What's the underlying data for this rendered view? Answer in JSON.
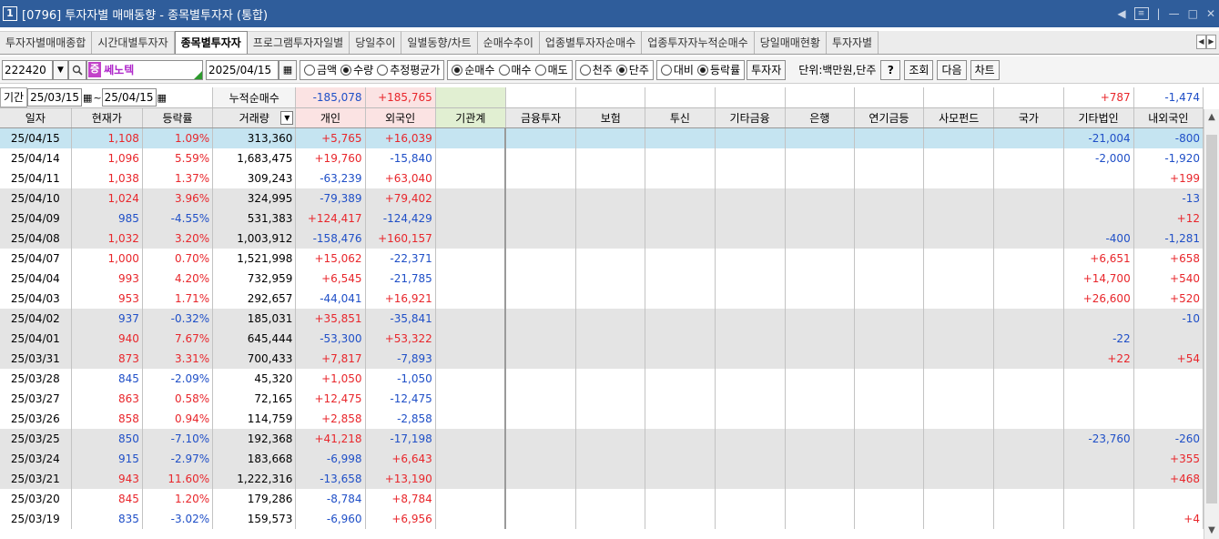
{
  "window": {
    "number": "1",
    "title": "[0796] 투자자별 매매동향 - 종목별투자자 (통합)"
  },
  "tabs": [
    {
      "label": "투자자별매매종합"
    },
    {
      "label": "시간대별투자자"
    },
    {
      "label": "종목별투자자",
      "active": true
    },
    {
      "label": "프로그램투자자일별"
    },
    {
      "label": "당일추이"
    },
    {
      "label": "일별동향/차트"
    },
    {
      "label": "순매수추이"
    },
    {
      "label": "업종별투자자순매수"
    },
    {
      "label": "업종투자자누적순매수"
    },
    {
      "label": "당일매매현황"
    },
    {
      "label": "투자자별"
    }
  ],
  "toolbar": {
    "code": "222420",
    "badge": "증",
    "name": "쎄노텍",
    "date": "2025/04/15",
    "amount_group": [
      "금액",
      "수량",
      "추정평균가"
    ],
    "amount_selected": 1,
    "trade_group": [
      "순매수",
      "매수",
      "매도"
    ],
    "trade_selected": 0,
    "unit_group": [
      "천주",
      "단주"
    ],
    "unit_selected": 1,
    "rate_group": [
      "대비",
      "등락률"
    ],
    "rate_selected": 1,
    "investor_btn": "투자자",
    "unit_label": "단위:백만원,단주",
    "help_btn": "?",
    "query_btn": "조회",
    "next_btn": "다음",
    "chart_btn": "차트"
  },
  "period": {
    "label": "기간",
    "from": "25/03/15",
    "to": "25/04/15",
    "cum_label": "누적순매수"
  },
  "summary": {
    "indiv": "-185,078",
    "foreign": "+185,765",
    "etc_corp": "+787",
    "domestic_foreign": "-1,474"
  },
  "columns": [
    "일자",
    "현재가",
    "등락률",
    "거래량",
    "개인",
    "외국인",
    "기관계",
    "금융투자",
    "보험",
    "투신",
    "기타금융",
    "은행",
    "연기금등",
    "사모펀드",
    "국가",
    "기타법인",
    "내외국인"
  ],
  "rows": [
    {
      "date": "25/04/15",
      "price": "1,108",
      "rate": "1.09%",
      "vol": "313,360",
      "indiv": "+5,765",
      "foreign": "+16,039",
      "etc_corp": "-21,004",
      "dom": "-800",
      "dir": "up",
      "style": "sel"
    },
    {
      "date": "25/04/14",
      "price": "1,096",
      "rate": "5.59%",
      "vol": "1,683,475",
      "indiv": "+19,760",
      "foreign": "-15,840",
      "etc_corp": "-2,000",
      "dom": "-1,920",
      "dir": "up",
      "style": ""
    },
    {
      "date": "25/04/11",
      "price": "1,038",
      "rate": "1.37%",
      "vol": "309,243",
      "indiv": "-63,239",
      "foreign": "+63,040",
      "etc_corp": "",
      "dom": "+199",
      "dir": "up",
      "style": ""
    },
    {
      "date": "25/04/10",
      "price": "1,024",
      "rate": "3.96%",
      "vol": "324,995",
      "indiv": "-79,389",
      "foreign": "+79,402",
      "etc_corp": "",
      "dom": "-13",
      "dir": "up",
      "style": "gray"
    },
    {
      "date": "25/04/09",
      "price": "985",
      "rate": "-4.55%",
      "vol": "531,383",
      "indiv": "+124,417",
      "foreign": "-124,429",
      "etc_corp": "",
      "dom": "+12",
      "dir": "dn",
      "style": "gray"
    },
    {
      "date": "25/04/08",
      "price": "1,032",
      "rate": "3.20%",
      "vol": "1,003,912",
      "indiv": "-158,476",
      "foreign": "+160,157",
      "etc_corp": "-400",
      "dom": "-1,281",
      "dir": "up",
      "style": "gray"
    },
    {
      "date": "25/04/07",
      "price": "1,000",
      "rate": "0.70%",
      "vol": "1,521,998",
      "indiv": "+15,062",
      "foreign": "-22,371",
      "etc_corp": "+6,651",
      "dom": "+658",
      "dir": "up",
      "style": ""
    },
    {
      "date": "25/04/04",
      "price": "993",
      "rate": "4.20%",
      "vol": "732,959",
      "indiv": "+6,545",
      "foreign": "-21,785",
      "etc_corp": "+14,700",
      "dom": "+540",
      "dir": "up",
      "style": ""
    },
    {
      "date": "25/04/03",
      "price": "953",
      "rate": "1.71%",
      "vol": "292,657",
      "indiv": "-44,041",
      "foreign": "+16,921",
      "etc_corp": "+26,600",
      "dom": "+520",
      "dir": "up",
      "style": ""
    },
    {
      "date": "25/04/02",
      "price": "937",
      "rate": "-0.32%",
      "vol": "185,031",
      "indiv": "+35,851",
      "foreign": "-35,841",
      "etc_corp": "",
      "dom": "-10",
      "dir": "dn",
      "style": "gray"
    },
    {
      "date": "25/04/01",
      "price": "940",
      "rate": "7.67%",
      "vol": "645,444",
      "indiv": "-53,300",
      "foreign": "+53,322",
      "etc_corp": "-22",
      "dom": "",
      "dir": "up",
      "style": "gray"
    },
    {
      "date": "25/03/31",
      "price": "873",
      "rate": "3.31%",
      "vol": "700,433",
      "indiv": "+7,817",
      "foreign": "-7,893",
      "etc_corp": "+22",
      "dom": "+54",
      "dir": "up",
      "style": "gray"
    },
    {
      "date": "25/03/28",
      "price": "845",
      "rate": "-2.09%",
      "vol": "45,320",
      "indiv": "+1,050",
      "foreign": "-1,050",
      "etc_corp": "",
      "dom": "",
      "dir": "dn",
      "style": ""
    },
    {
      "date": "25/03/27",
      "price": "863",
      "rate": "0.58%",
      "vol": "72,165",
      "indiv": "+12,475",
      "foreign": "-12,475",
      "etc_corp": "",
      "dom": "",
      "dir": "up",
      "style": ""
    },
    {
      "date": "25/03/26",
      "price": "858",
      "rate": "0.94%",
      "vol": "114,759",
      "indiv": "+2,858",
      "foreign": "-2,858",
      "etc_corp": "",
      "dom": "",
      "dir": "up",
      "style": ""
    },
    {
      "date": "25/03/25",
      "price": "850",
      "rate": "-7.10%",
      "vol": "192,368",
      "indiv": "+41,218",
      "foreign": "-17,198",
      "etc_corp": "-23,760",
      "dom": "-260",
      "dir": "dn",
      "style": "gray"
    },
    {
      "date": "25/03/24",
      "price": "915",
      "rate": "-2.97%",
      "vol": "183,668",
      "indiv": "-6,998",
      "foreign": "+6,643",
      "etc_corp": "",
      "dom": "+355",
      "dir": "dn",
      "style": "gray"
    },
    {
      "date": "25/03/21",
      "price": "943",
      "rate": "11.60%",
      "vol": "1,222,316",
      "indiv": "-13,658",
      "foreign": "+13,190",
      "etc_corp": "",
      "dom": "+468",
      "dir": "up",
      "style": "gray"
    },
    {
      "date": "25/03/20",
      "price": "845",
      "rate": "1.20%",
      "vol": "179,286",
      "indiv": "-8,784",
      "foreign": "+8,784",
      "etc_corp": "",
      "dom": "",
      "dir": "up",
      "style": ""
    },
    {
      "date": "25/03/19",
      "price": "835",
      "rate": "-3.02%",
      "vol": "159,573",
      "indiv": "-6,960",
      "foreign": "+6,956",
      "etc_corp": "",
      "dom": "+4",
      "dir": "dn",
      "style": ""
    }
  ],
  "colors": {
    "up": "#e8262b",
    "down": "#1f4fc7",
    "title_bg": "#2f5d9b",
    "selected_row": "#c5e4f1",
    "gray_row": "#e4e4e4",
    "indiv_header": "#fbe3e3",
    "foreign_header": "#fbe3e3",
    "inst_header": "#e1efd2"
  },
  "icons": {
    "search": "search-icon",
    "calendar": "calendar-icon",
    "dropdown": "chevron-down-icon",
    "sort": "sort-down-icon"
  }
}
